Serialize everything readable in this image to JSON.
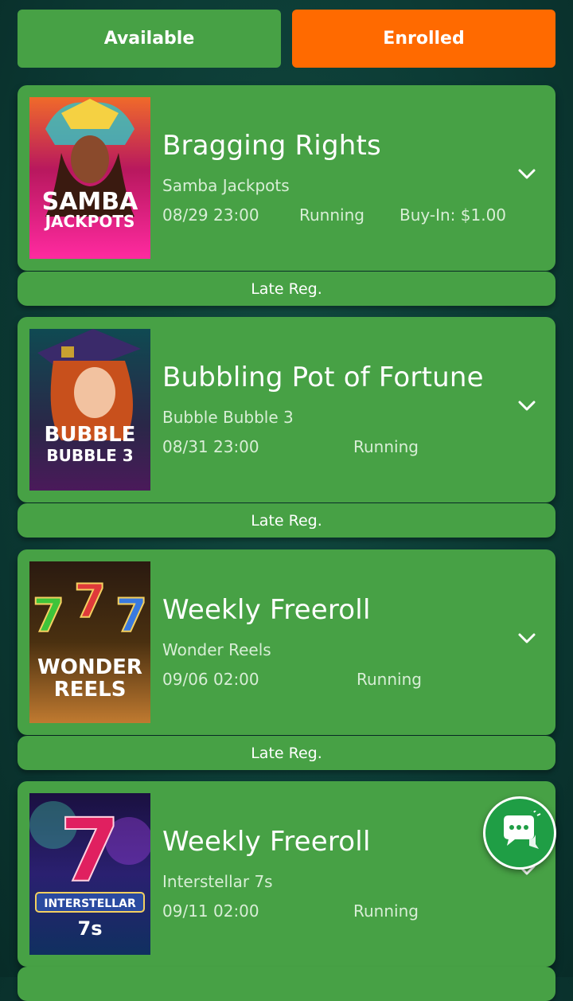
{
  "tabs": {
    "available": "Available",
    "enrolled": "Enrolled"
  },
  "colors": {
    "card": "#47a145",
    "enrolled_tab": "#ff6a00",
    "background": "#0c3b35"
  },
  "tournaments": [
    {
      "title": "Bragging Rights",
      "game": "Samba Jackpots",
      "date": "08/29 23:00",
      "status": "Running",
      "buyin": "Buy-In: $1.00",
      "late_reg": "Late Reg.",
      "thumb_text": [
        "SAMBA",
        "JACKPOTS"
      ]
    },
    {
      "title": "Bubbling Pot of Fortune",
      "game": "Bubble Bubble 3",
      "date": "08/31 23:00",
      "status": "Running",
      "late_reg": "Late Reg.",
      "thumb_text": [
        "BUBBLE",
        "BUBBLE 3"
      ]
    },
    {
      "title": "Weekly Freeroll",
      "game": "Wonder Reels",
      "date": "09/06 02:00",
      "status": "Running",
      "late_reg": "Late Reg.",
      "thumb_text": [
        "WONDER",
        "REELS"
      ]
    },
    {
      "title": "Weekly Freeroll",
      "game": "Interstellar 7s",
      "date": "09/11 02:00",
      "status": "Running",
      "thumb_text": [
        "INTERSTELLAR",
        "7s"
      ]
    }
  ],
  "icons": {
    "expand": "chevron-down-icon",
    "chat": "chat-icon"
  }
}
